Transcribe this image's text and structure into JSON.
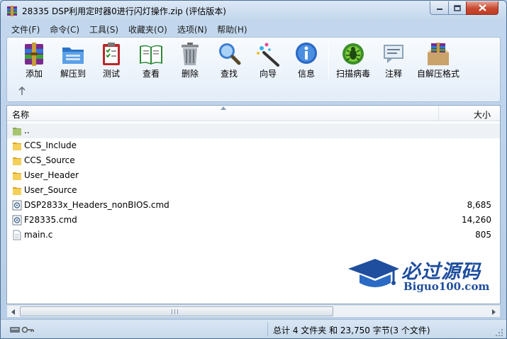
{
  "window": {
    "title": "28335 DSP利用定时器0进行闪灯操作.zip (评估版本)"
  },
  "menu": [
    "文件(F)",
    "命令(C)",
    "工具(S)",
    "收藏夹(O)",
    "选项(N)",
    "帮助(H)"
  ],
  "toolbar": {
    "items": [
      {
        "label": "添加",
        "icon": "add-archive-icon"
      },
      {
        "label": "解压到",
        "icon": "extract-folder-icon"
      },
      {
        "label": "测试",
        "icon": "test-clipboard-icon"
      },
      {
        "label": "查看",
        "icon": "view-book-icon"
      },
      {
        "label": "删除",
        "icon": "trash-can-icon"
      },
      {
        "label": "查找",
        "icon": "magnifier-icon"
      },
      {
        "label": "向导",
        "icon": "wizard-wand-icon"
      },
      {
        "label": "信息",
        "icon": "info-icon"
      },
      {
        "label": "扫描病毒",
        "icon": "virus-scan-icon"
      },
      {
        "label": "注释",
        "icon": "comment-icon"
      },
      {
        "label": "自解压格式",
        "icon": "sfx-archive-icon"
      }
    ]
  },
  "list": {
    "columns": {
      "name": "名称",
      "size": "大小"
    },
    "rows": [
      {
        "name": "..",
        "size": "",
        "type": "parent-folder"
      },
      {
        "name": "CCS_Include",
        "size": "",
        "type": "folder"
      },
      {
        "name": "CCS_Source",
        "size": "",
        "type": "folder"
      },
      {
        "name": "User_Header",
        "size": "",
        "type": "folder"
      },
      {
        "name": "User_Source",
        "size": "",
        "type": "folder"
      },
      {
        "name": "DSP2833x_Headers_nonBIOS.cmd",
        "size": "8,685",
        "type": "cmd-file"
      },
      {
        "name": "F28335.cmd",
        "size": "14,260",
        "type": "cmd-file"
      },
      {
        "name": "main.c",
        "size": "805",
        "type": "text-file"
      }
    ]
  },
  "watermark": {
    "cn": "必过源码",
    "en": "Biguo100.com"
  },
  "status": {
    "summary": "总计 4 文件夹 和 23,750 字节(3 个文件)"
  },
  "colors": {
    "accent": "#1f4e9e",
    "close": "#c74a31"
  }
}
